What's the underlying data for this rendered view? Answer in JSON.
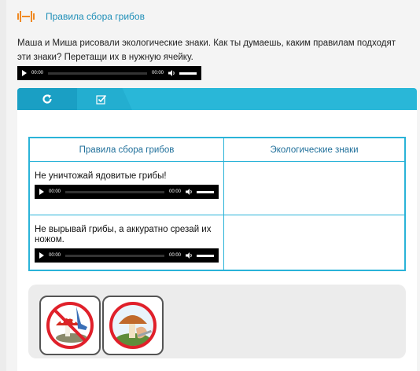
{
  "header": {
    "title": "Правила сбора грибов",
    "logo_icon": "eco-logo-icon"
  },
  "task": {
    "text": "Маша и Миша рисовали экологические знаки. Как ты думаешь, каким правилам подходят эти знаки? Перетащи их в нужную ячейку."
  },
  "audio": {
    "current_time": "00:00",
    "duration": "00:00"
  },
  "toolbar": {
    "refresh_icon": "refresh-icon",
    "check_icon": "check-icon"
  },
  "table": {
    "headers": [
      "Правила сбора грибов",
      "Экологические знаки"
    ],
    "rows": [
      {
        "rule": "Не уничтожай ядовитые грибы!",
        "sign": ""
      },
      {
        "rule": "Не вырывай грибы, а аккуратно срезай их ножом.",
        "sign": ""
      }
    ]
  },
  "cards": [
    {
      "icon": "no-kicking-mushroom-icon"
    },
    {
      "icon": "cutting-mushroom-knife-icon"
    }
  ],
  "colors": {
    "accent": "#29b7d8",
    "title": "#1f8fb8",
    "forbid": "#e0202a"
  }
}
